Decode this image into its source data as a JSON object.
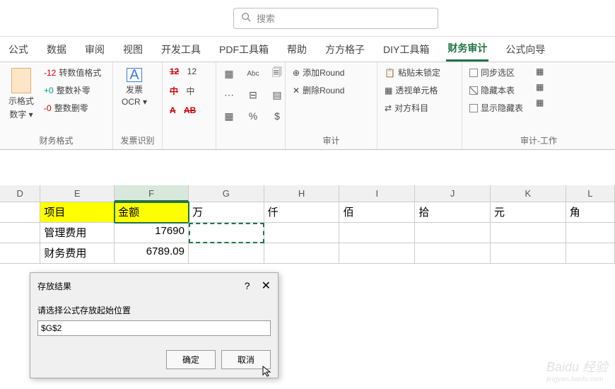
{
  "search": {
    "placeholder": "搜索"
  },
  "tabs": [
    "公式",
    "数据",
    "审阅",
    "视图",
    "开发工具",
    "PDF工具箱",
    "帮助",
    "方方格子",
    "DIY工具箱",
    "财务审计",
    "公式向导"
  ],
  "active_tab_index": 9,
  "ribbon": {
    "g1": {
      "label": "财务格式",
      "big": [
        "示格式",
        "数字"
      ],
      "items": [
        "转数值格式",
        "整数补零",
        "整数删零"
      ],
      "prefixes": [
        "-12",
        "+0",
        "-0"
      ]
    },
    "g2": {
      "label": "发票识别",
      "btn": [
        "发票",
        "OCR"
      ]
    },
    "g3_icons": [
      "12",
      "12",
      "中",
      "中",
      "A",
      "AB"
    ],
    "g4_icons": [
      "Abc",
      "%",
      "$"
    ],
    "g5": {
      "label": "审计",
      "addRound": "添加Round",
      "delRound": "删除Round"
    },
    "g6": {
      "paste": "粘贴未锁定",
      "trans": "透视单元格",
      "dui": "对方科目"
    },
    "g7": {
      "label": "审计-工作",
      "sync": "同步选区",
      "hide": "隐藏本表",
      "show": "显示隐藏表"
    }
  },
  "columns": [
    "D",
    "E",
    "F",
    "G",
    "H",
    "I",
    "J",
    "K",
    "L"
  ],
  "selected_col_index": 2,
  "rows": [
    [
      "",
      "项目",
      "金额",
      "万",
      "仟",
      "佰",
      "拾",
      "元",
      "角"
    ],
    [
      "",
      "管理费用",
      "17690",
      "",
      "",
      "",
      "",
      "",
      ""
    ],
    [
      "",
      "财务费用",
      "6789.09",
      "",
      "",
      "",
      "",
      "",
      ""
    ]
  ],
  "header_row": 0,
  "number_cols": [
    2
  ],
  "dialog": {
    "title": "存放结果",
    "label": "请选择公式存放起始位置",
    "value": "$G$2",
    "ok": "确定",
    "cancel": "取消"
  },
  "watermark": {
    "main": "Baidu 经验",
    "sub": "jingyan.baidu.com"
  }
}
